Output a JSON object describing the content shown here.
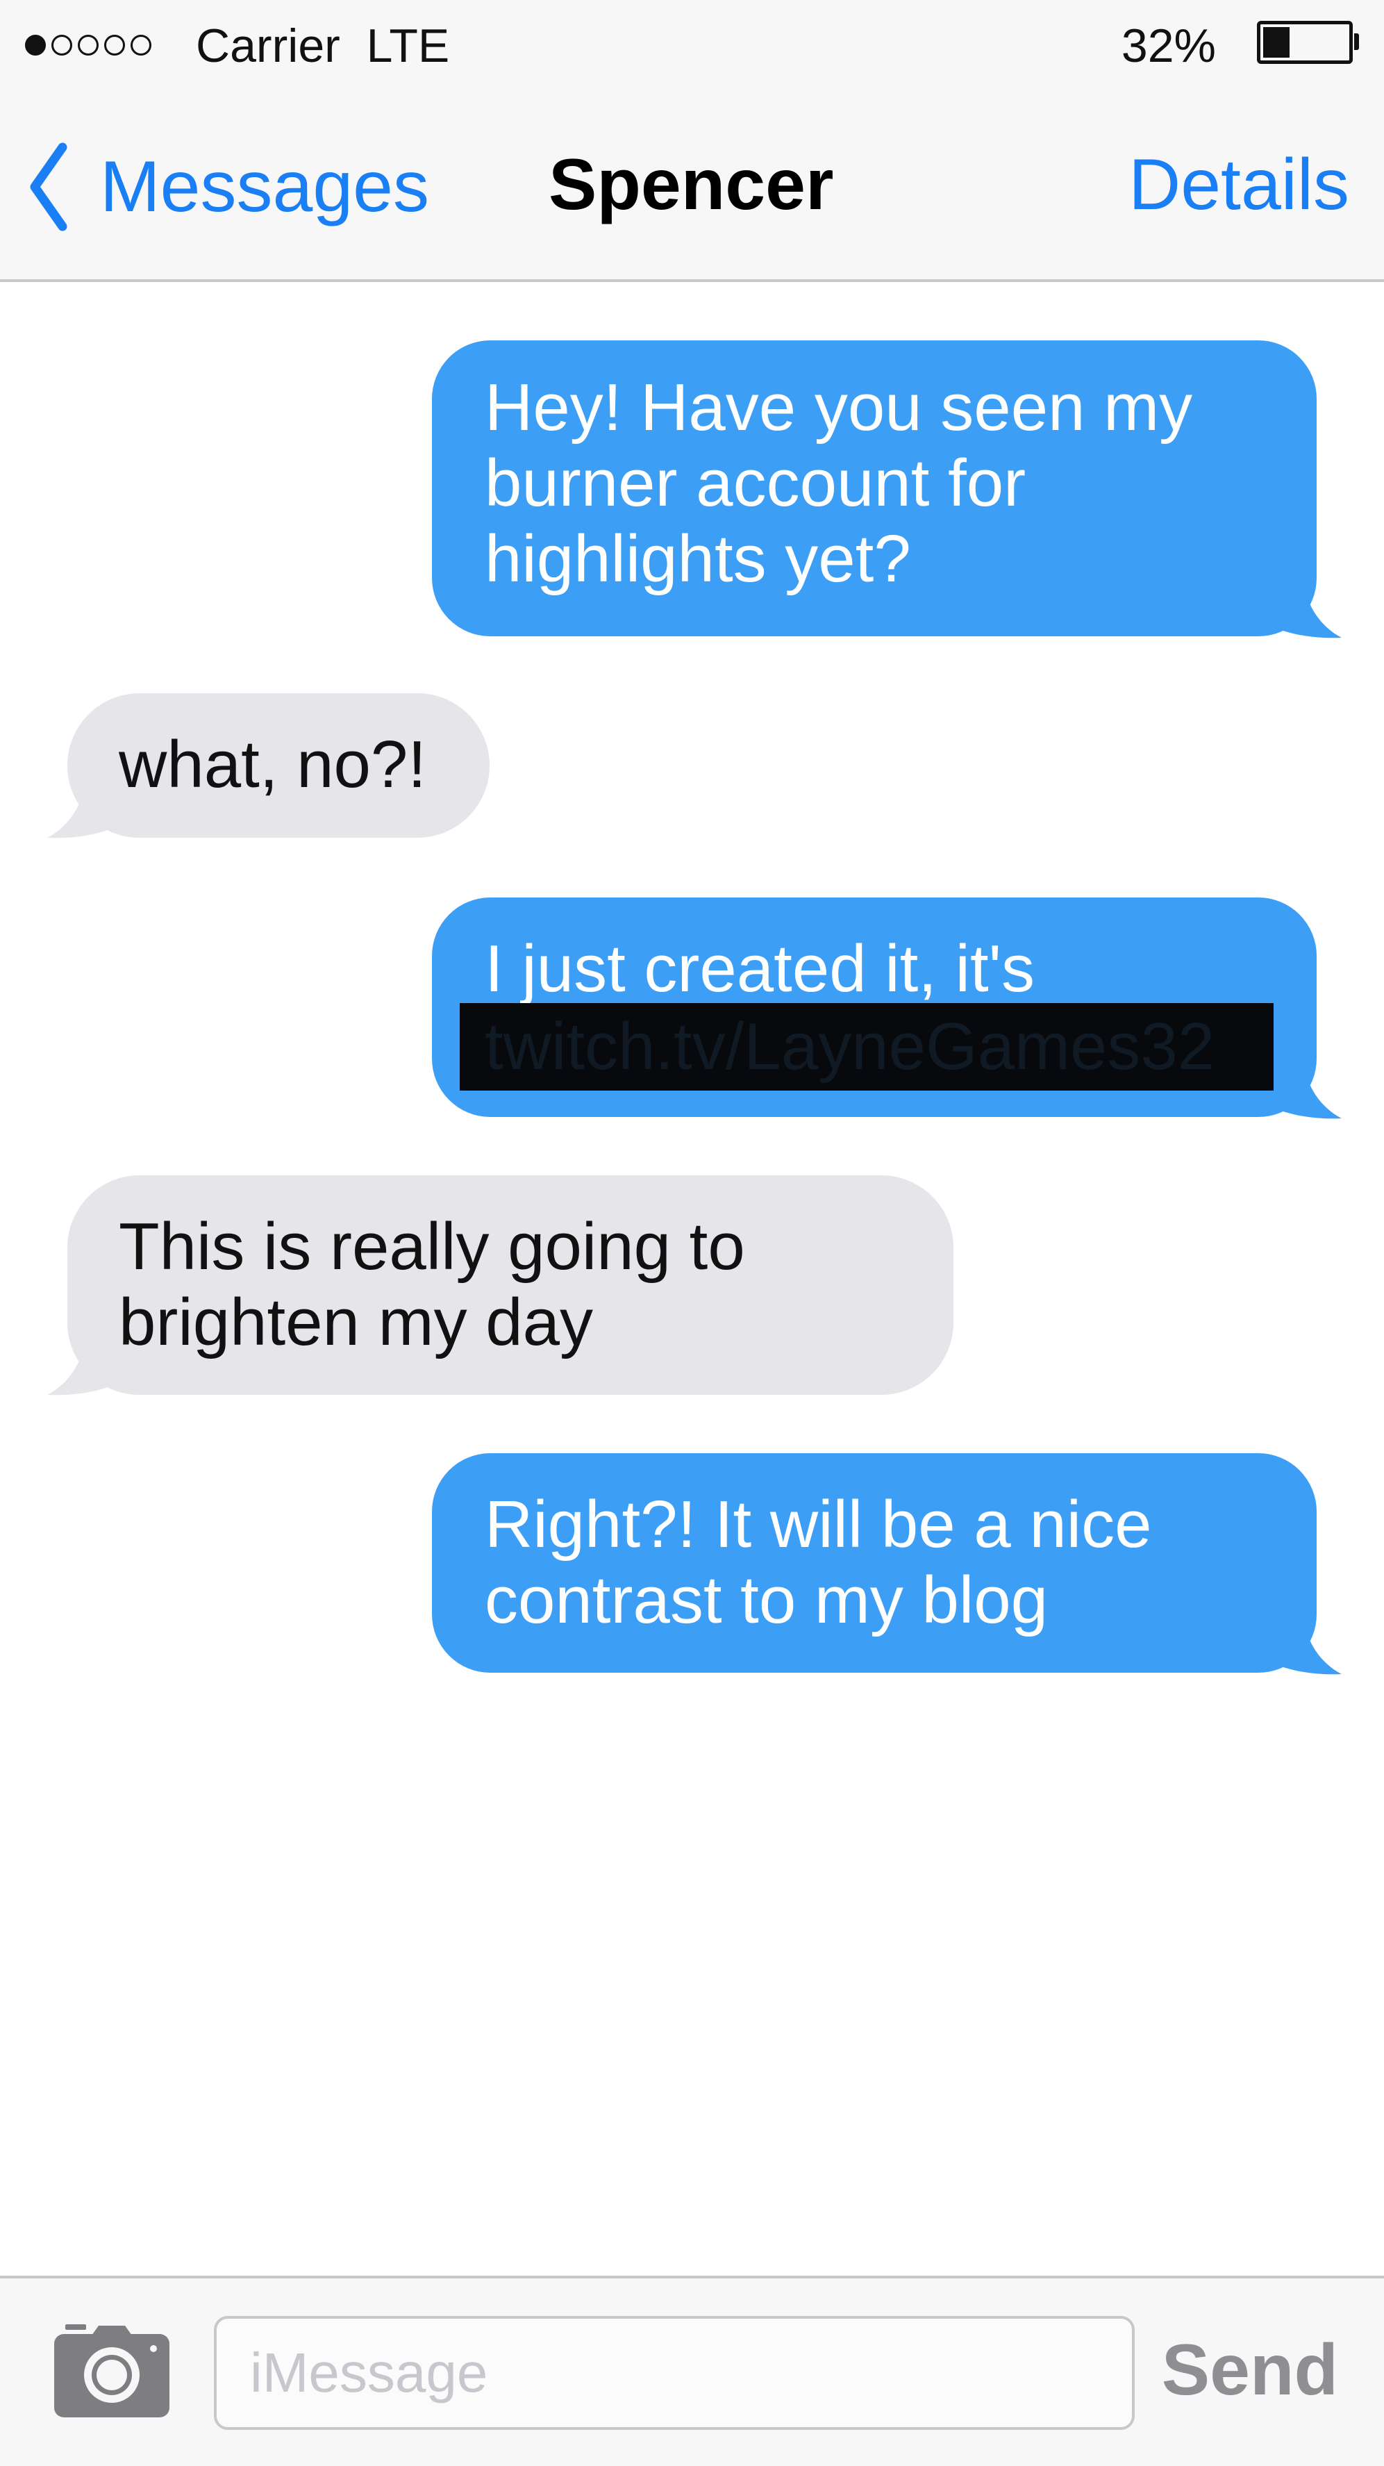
{
  "status_bar": {
    "signal_dots_total": 5,
    "signal_dots_filled": 1,
    "carrier": "Carrier",
    "network": "LTE",
    "battery_percent_text": "32%",
    "battery_level": 0.32
  },
  "nav_bar": {
    "back_label": "Messages",
    "title": "Spencer",
    "details_label": "Details",
    "back_icon": "chevron-left-icon"
  },
  "messages": [
    {
      "direction": "outgoing",
      "text": "Hey! Have you seen my\nburner account for\nhighlights yet?"
    },
    {
      "direction": "incoming",
      "text": "what, no?!"
    },
    {
      "direction": "outgoing",
      "text": "I just created it, it's",
      "redacted_text": "twitch.tv/LayneGames32"
    },
    {
      "direction": "incoming",
      "text": "This is really going to\nbrighten my day"
    },
    {
      "direction": "outgoing",
      "text": "Right?! It will be a nice\ncontrast to my blog"
    }
  ],
  "input_bar": {
    "camera_icon": "camera-icon",
    "placeholder": "iMessage",
    "value": "",
    "send_label": "Send"
  },
  "colors": {
    "accent_blue": "#1a7ef4",
    "outgoing_bubble": "#3c9ff5",
    "incoming_bubble": "#e5e5ea",
    "bar_background": "#f7f7f7",
    "send_disabled": "#8e8e93",
    "redaction": "#07090c"
  }
}
